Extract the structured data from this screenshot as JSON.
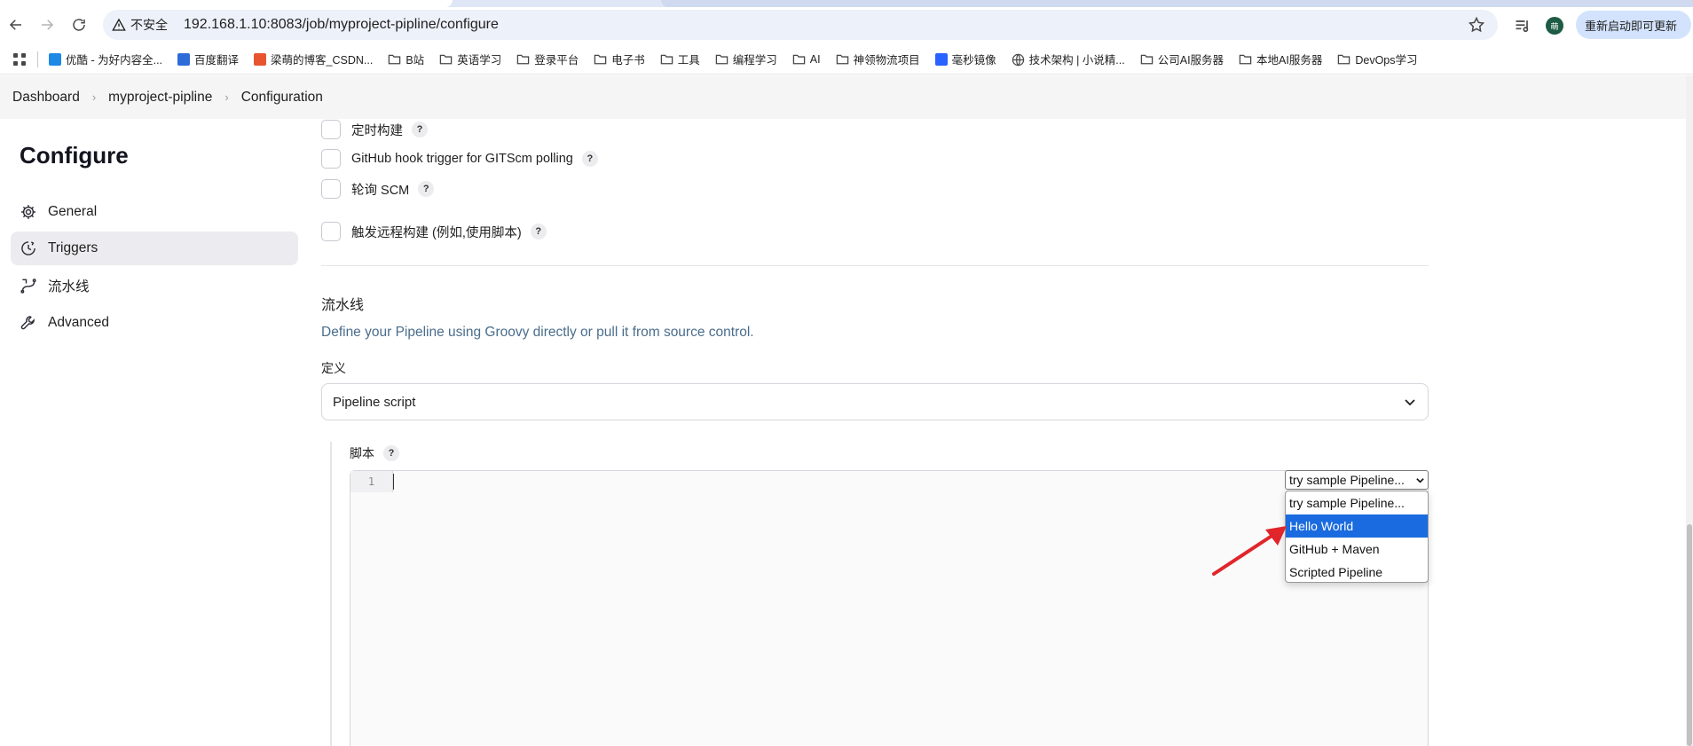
{
  "browser": {
    "security_label": "不安全",
    "url": "192.168.1.10:8083/job/myproject-pipline/configure",
    "profile_initial": "萌",
    "update_label": "重新启动即可更新"
  },
  "bookmarks": [
    {
      "label": "优酷 - 为好内容全...",
      "icon": "youku-icon",
      "color": "#1e88e5"
    },
    {
      "label": "百度翻译",
      "icon": "baidu-translate-icon",
      "color": "#2f6bd8"
    },
    {
      "label": "梁萌的博客_CSDN...",
      "icon": "csdn-icon",
      "color": "#e8542f"
    },
    {
      "label": "B站",
      "icon": "folder-icon"
    },
    {
      "label": "英语学习",
      "icon": "folder-icon"
    },
    {
      "label": "登录平台",
      "icon": "folder-icon"
    },
    {
      "label": "电子书",
      "icon": "folder-icon"
    },
    {
      "label": "工具",
      "icon": "folder-icon"
    },
    {
      "label": "编程学习",
      "icon": "folder-icon"
    },
    {
      "label": "AI",
      "icon": "folder-icon"
    },
    {
      "label": "神领物流项目",
      "icon": "folder-icon"
    },
    {
      "label": "毫秒镜像",
      "icon": "mirror-icon",
      "color": "#2962ff"
    },
    {
      "label": "技术架构 | 小说精...",
      "icon": "globe-icon"
    },
    {
      "label": "公司AI服务器",
      "icon": "folder-icon"
    },
    {
      "label": "本地AI服务器",
      "icon": "folder-icon"
    },
    {
      "label": "DevOps学习",
      "icon": "folder-icon"
    }
  ],
  "breadcrumb": {
    "items": [
      "Dashboard",
      "myproject-pipline",
      "Configuration"
    ]
  },
  "sidebar": {
    "title": "Configure",
    "items": [
      {
        "label": "General",
        "icon": "gear-icon"
      },
      {
        "label": "Triggers",
        "icon": "clock-icon",
        "active": true
      },
      {
        "label": "流水线",
        "icon": "pipeline-icon"
      },
      {
        "label": "Advanced",
        "icon": "wrench-icon"
      }
    ]
  },
  "triggers": {
    "options": [
      {
        "label": "定时构建",
        "checked": false
      },
      {
        "label": "GitHub hook trigger for GITScm polling",
        "checked": false
      },
      {
        "label": "轮询 SCM",
        "checked": false
      },
      {
        "label": "触发远程构建 (例如,使用脚本)",
        "checked": false
      }
    ],
    "help": "?"
  },
  "pipeline": {
    "section_title": "流水线",
    "description": "Define your Pipeline using Groovy directly or pull it from source control.",
    "definition_label": "定义",
    "definition_value": "Pipeline script",
    "script_label": "脚本",
    "line_number": "1",
    "sample_select_value": "try sample Pipeline...",
    "sample_options": [
      "try sample Pipeline...",
      "Hello World",
      "GitHub + Maven",
      "Scripted Pipeline"
    ],
    "highlighted_option": "Hello World"
  },
  "colors": {
    "accent": "#1a6bdf",
    "annotation_arrow": "#e0262b",
    "description_text": "#4a6d8c"
  }
}
